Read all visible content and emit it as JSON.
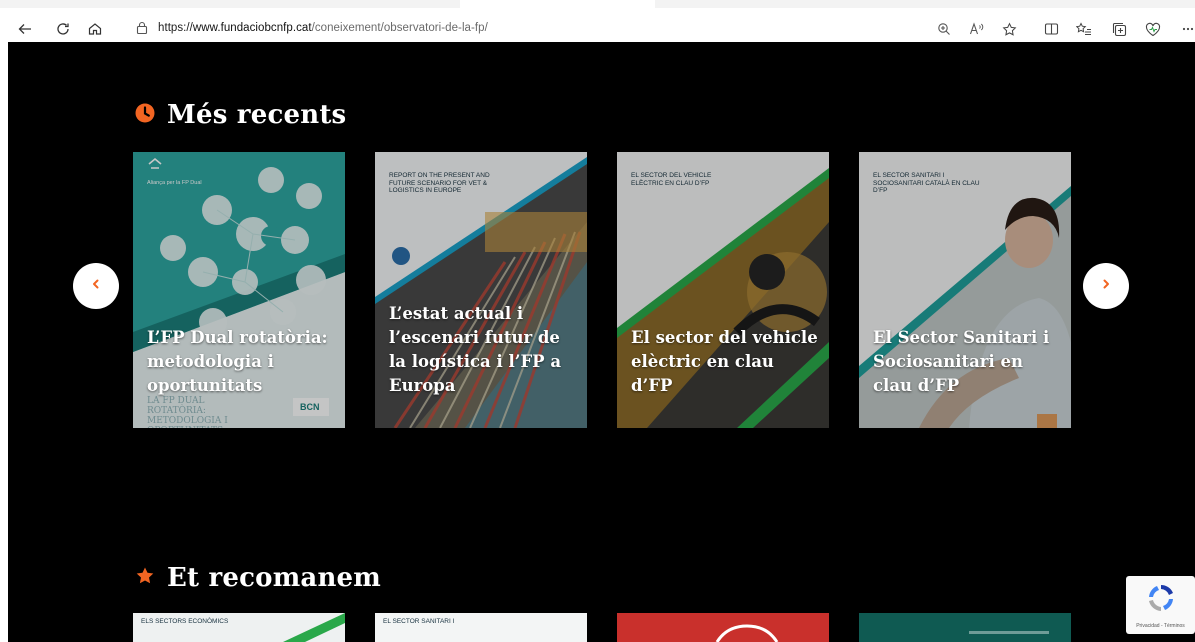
{
  "browser": {
    "url_prefix": "https://",
    "url_domain": "www.fundaciobcnfp.cat",
    "url_path": "/coneixement/observatori-de-la-fp/"
  },
  "sections": {
    "recent_title": "Més recents",
    "recommended_title": "Et recomanem"
  },
  "recent_cards": [
    {
      "caption": "L’FP Dual rotatòria: metodologia i oportunitats",
      "cover_top_text": "Aliança per la FP Dual",
      "cover_bottom_text": "LA FP DUAL ROTATÒRIA: METODOLOGIA I OPORTUNITATS",
      "cover_logo": "BCN"
    },
    {
      "caption": "L’estat actual i l’escenari futur de la logística i l’FP a Europa",
      "cover_top_text": "REPORT ON THE PRESENT AND FUTURE SCENARIO FOR VET & LOGISTICS IN EUROPE"
    },
    {
      "caption": "El sector del vehicle elèctric en clau d’FP",
      "cover_top_text": "EL SECTOR DEL VEHICLE ELÈCTRIC EN CLAU D’FP"
    },
    {
      "caption": "El Sector Sanitari i Sociosanitari en clau d’FP",
      "cover_top_text": "EL SECTOR SANITARI I SOCIOSANITARI CATALÀ EN CLAU D’FP"
    }
  ],
  "recommended_cards": [
    {
      "cover_top_text": "ELS SECTORS ECONÒMICS"
    },
    {
      "cover_top_text": "EL SECTOR SANITARI I"
    },
    {
      "cover_top_text": ""
    },
    {
      "cover_top_text": ""
    }
  ],
  "recaptcha": {
    "text": "Privacidad - Términos"
  },
  "colors": {
    "accent": "#f26522",
    "page_bg": "#000000",
    "teal": "#1f9e9a",
    "green": "#2aa84a"
  }
}
